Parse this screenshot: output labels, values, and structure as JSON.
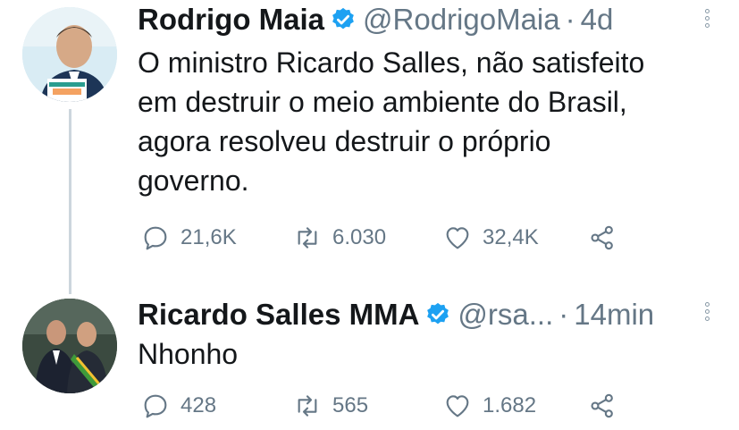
{
  "tweets": [
    {
      "author_name": "Rodrigo Maia",
      "handle": "@RodrigoMaia",
      "separator": "·",
      "time": "4d",
      "text_lines": [
        "O ministro Ricardo Salles, não satisfeito",
        "em destruir o meio ambiente do Brasil,",
        "agora resolveu destruir o próprio",
        "governo."
      ],
      "replies": "21,6K",
      "retweets": "6.030",
      "likes": "32,4K",
      "avatar_icon": "profile-photo"
    },
    {
      "author_name": "Ricardo Salles MMA",
      "handle": "@rsa...",
      "separator": "·",
      "time": "14min",
      "text_lines": [
        "Nhonho"
      ],
      "replies": "428",
      "retweets": "565",
      "likes": "1.682",
      "avatar_icon": "profile-photo"
    }
  ],
  "colors": {
    "verified": "#1da1f2",
    "secondary_text": "#657786",
    "thread_line": "#ccd6dd"
  }
}
